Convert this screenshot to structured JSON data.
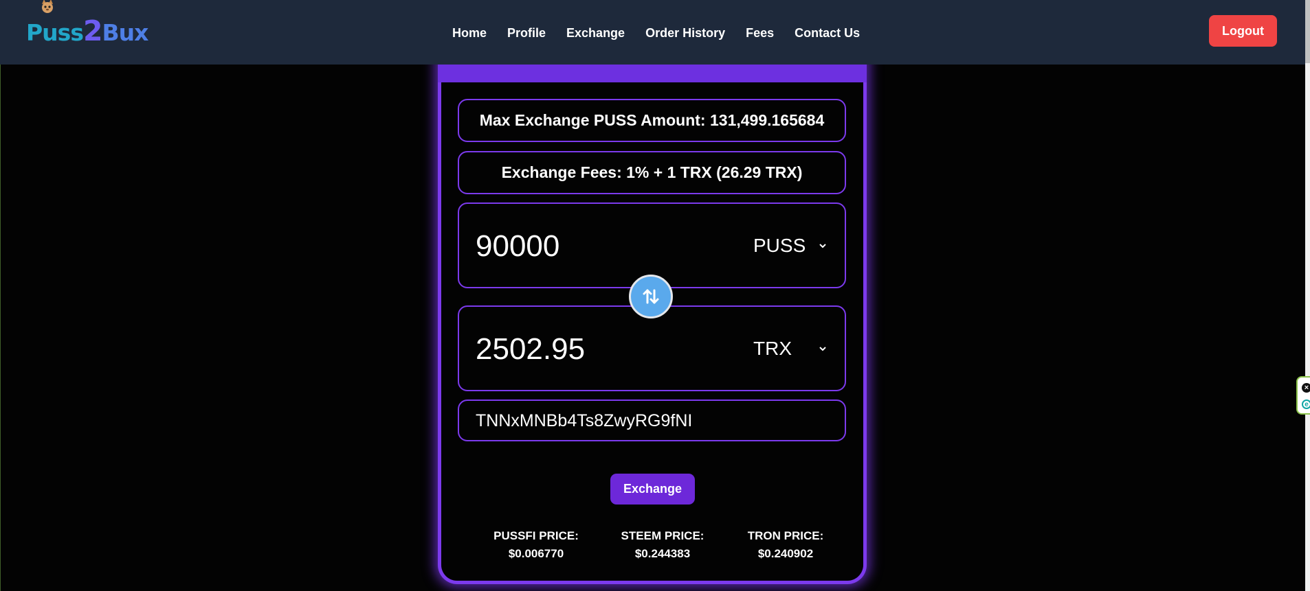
{
  "brand": {
    "logo_part1": "Puss",
    "logo_part2": "2",
    "logo_part3": "Bux"
  },
  "nav": {
    "items": [
      {
        "label": "Home"
      },
      {
        "label": "Profile"
      },
      {
        "label": "Exchange"
      },
      {
        "label": "Order History"
      },
      {
        "label": "Fees"
      },
      {
        "label": "Contact Us"
      }
    ],
    "logout_label": "Logout"
  },
  "exchange": {
    "max_amount_text": "Max Exchange PUSS Amount: 131,499.165684",
    "fees_text": "Exchange Fees: 1% + 1 TRX (26.29 TRX)",
    "from": {
      "amount": "90000",
      "currency": "PUSS"
    },
    "to": {
      "amount": "2502.95",
      "currency": "TRX"
    },
    "address": "TNNxMNBb4Ts8ZwyRG9fNI",
    "exchange_button_label": "Exchange"
  },
  "prices": [
    {
      "label": "PUSSFI PRICE:",
      "value": "$0.006770"
    },
    {
      "label": "STEEM PRICE:",
      "value": "$0.244383"
    },
    {
      "label": "TRON PRICE:",
      "value": "$0.240902"
    }
  ],
  "colors": {
    "header_bg": "#1e293b",
    "accent_purple": "#7c3aed",
    "logout_red": "#ef4444",
    "swap_blue": "#5aa9ec",
    "page_bg": "#030303"
  },
  "icons": {
    "swap": "swap-vertical-arrows-icon",
    "dropdown": "chevron-down-icon",
    "widget_close": "close-circle-icon"
  }
}
